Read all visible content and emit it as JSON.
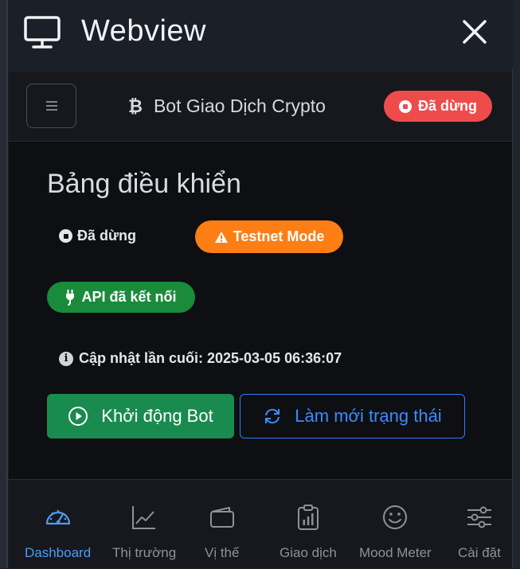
{
  "window": {
    "title": "Webview",
    "close_icon": "close-icon",
    "monitor_icon": "monitor-icon"
  },
  "navbar": {
    "menu_icon": "hamburger-menu-icon",
    "brand_symbol": "₿",
    "brand_text": "Bot Giao Dịch Crypto",
    "status_badge": "Đã dừng",
    "status_color": "#f04b4b"
  },
  "dashboard": {
    "title": "Bảng điều khiển",
    "bot_status": "Đã dừng",
    "mode_badge": "Testnet Mode",
    "mode_color": "#fd7e14",
    "api_badge": "API đã kết nối",
    "api_color": "#198b3b",
    "last_update": "Cập nhật lần cuối: 2025-03-05 06:36:07",
    "start_button": "Khởi động Bot",
    "refresh_button": "Làm mới trạng thái",
    "accent_color": "#3d8bfd"
  },
  "tabs": [
    {
      "label": "Dashboard",
      "icon": "speedometer-icon",
      "active": true
    },
    {
      "label": "Thị trường",
      "icon": "line-chart-icon",
      "active": false
    },
    {
      "label": "Vị thế",
      "icon": "wallet-icon",
      "active": false
    },
    {
      "label": "Giao dịch",
      "icon": "clipboard-chart-icon",
      "active": false
    },
    {
      "label": "Mood Meter",
      "icon": "smiley-icon",
      "active": false
    },
    {
      "label": "Cài đặt",
      "icon": "sliders-icon",
      "active": false
    }
  ]
}
